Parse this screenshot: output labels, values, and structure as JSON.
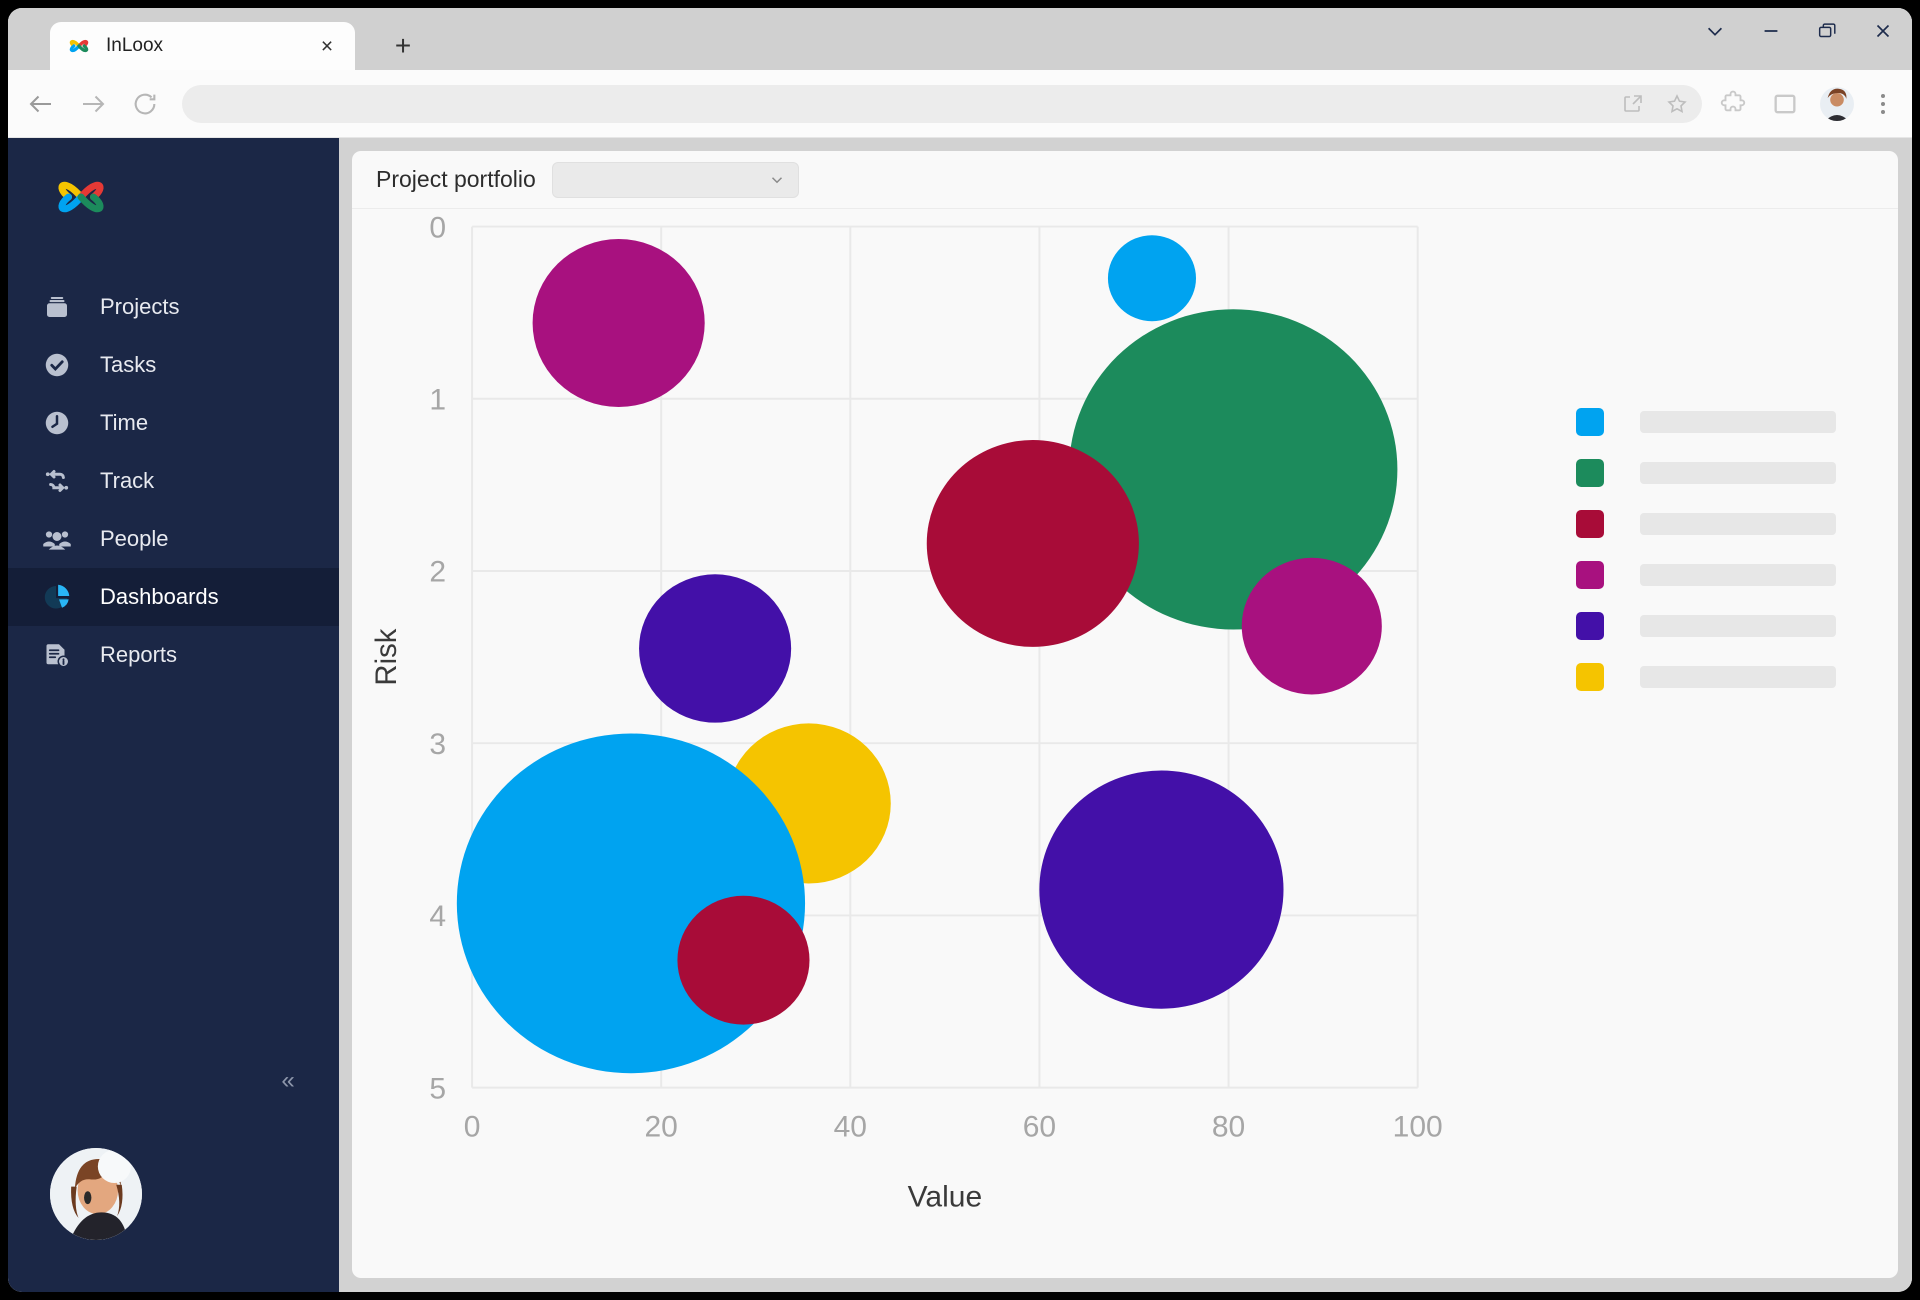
{
  "browser": {
    "tab": {
      "title": "InLoox",
      "favicon": "inloox-logo-icon",
      "close": "×"
    },
    "new_tab": "+",
    "window_controls": [
      {
        "name": "chevron-down-icon",
        "glyph": "⌄"
      },
      {
        "name": "minimize-icon",
        "glyph": "—"
      },
      {
        "name": "restore-window-icon",
        "glyph": "❐"
      },
      {
        "name": "close-window-icon",
        "glyph": "✕"
      }
    ],
    "nav": {
      "back": "back-arrow-icon",
      "forward": "forward-arrow-icon",
      "reload": "reload-icon"
    },
    "address_value": "",
    "address_placeholder": "",
    "toolbar_icons": [
      "share-icon",
      "bookmark-star-icon",
      "extensions-puzzle-icon",
      "browser-sidebar-icon",
      "profile-avatar",
      "kebab-menu-icon"
    ]
  },
  "sidebar": {
    "brand": "inloox-logo",
    "items": [
      {
        "label": "Projects",
        "icon": "briefcase-icon",
        "active": false
      },
      {
        "label": "Tasks",
        "icon": "check-circle-icon",
        "active": false
      },
      {
        "label": "Time",
        "icon": "clock-icon",
        "active": false
      },
      {
        "label": "Track",
        "icon": "track-arrows-icon",
        "active": false
      },
      {
        "label": "People",
        "icon": "people-icon",
        "active": false
      },
      {
        "label": "Dashboards",
        "icon": "pie-chart-icon",
        "active": true
      },
      {
        "label": "Reports",
        "icon": "report-info-icon",
        "active": false
      }
    ],
    "collapse": "«",
    "user_avatar": "user-avatar"
  },
  "header": {
    "label": "Project portfolio",
    "select_value": "",
    "select_chevron": "chevron-down-icon"
  },
  "colors": {
    "sidebar_bg": "#1b2746",
    "sidebar_active": "#141e38",
    "panel_bg": "#f9f9f9",
    "grid": "#e9e9e9",
    "axis_text": "#a6a6a6",
    "legend_bar": "#e7e7e7"
  },
  "chart_data": {
    "type": "scatter",
    "title": "",
    "xlabel": "Value",
    "ylabel": "Risk",
    "xlim": [
      0,
      100
    ],
    "ylim": [
      0,
      5
    ],
    "y_inverted": true,
    "grid": true,
    "xticks": [
      0,
      20,
      40,
      60,
      80,
      100
    ],
    "yticks": [
      0,
      1,
      2,
      3,
      4,
      5
    ],
    "legend_position": "right",
    "legend": [
      {
        "color": "#00A3F0",
        "label": ""
      },
      {
        "color": "#1C8B5C",
        "label": ""
      },
      {
        "color": "#A80C38",
        "label": ""
      },
      {
        "color": "#A8117F",
        "label": ""
      },
      {
        "color": "#4310A8",
        "label": ""
      },
      {
        "color": "#F5C400",
        "label": ""
      }
    ],
    "points": [
      {
        "x": 15.5,
        "y": 0.56,
        "size": 86,
        "color": "#A8117F"
      },
      {
        "x": 71.9,
        "y": 0.3,
        "size": 44,
        "color": "#00A3F0"
      },
      {
        "x": 80.5,
        "y": 1.41,
        "size": 164,
        "color": "#1C8B5C"
      },
      {
        "x": 59.3,
        "y": 1.84,
        "size": 106,
        "color": "#A80C38"
      },
      {
        "x": 88.8,
        "y": 2.32,
        "size": 70,
        "color": "#A8117F"
      },
      {
        "x": 25.7,
        "y": 2.45,
        "size": 76,
        "color": "#4310A8"
      },
      {
        "x": 35.6,
        "y": 3.35,
        "size": 82,
        "color": "#F5C400"
      },
      {
        "x": 16.8,
        "y": 3.93,
        "size": 174,
        "color": "#00A3F0"
      },
      {
        "x": 72.9,
        "y": 3.85,
        "size": 122,
        "color": "#4310A8"
      },
      {
        "x": 28.7,
        "y": 4.26,
        "size": 66,
        "color": "#A80C38"
      }
    ]
  }
}
